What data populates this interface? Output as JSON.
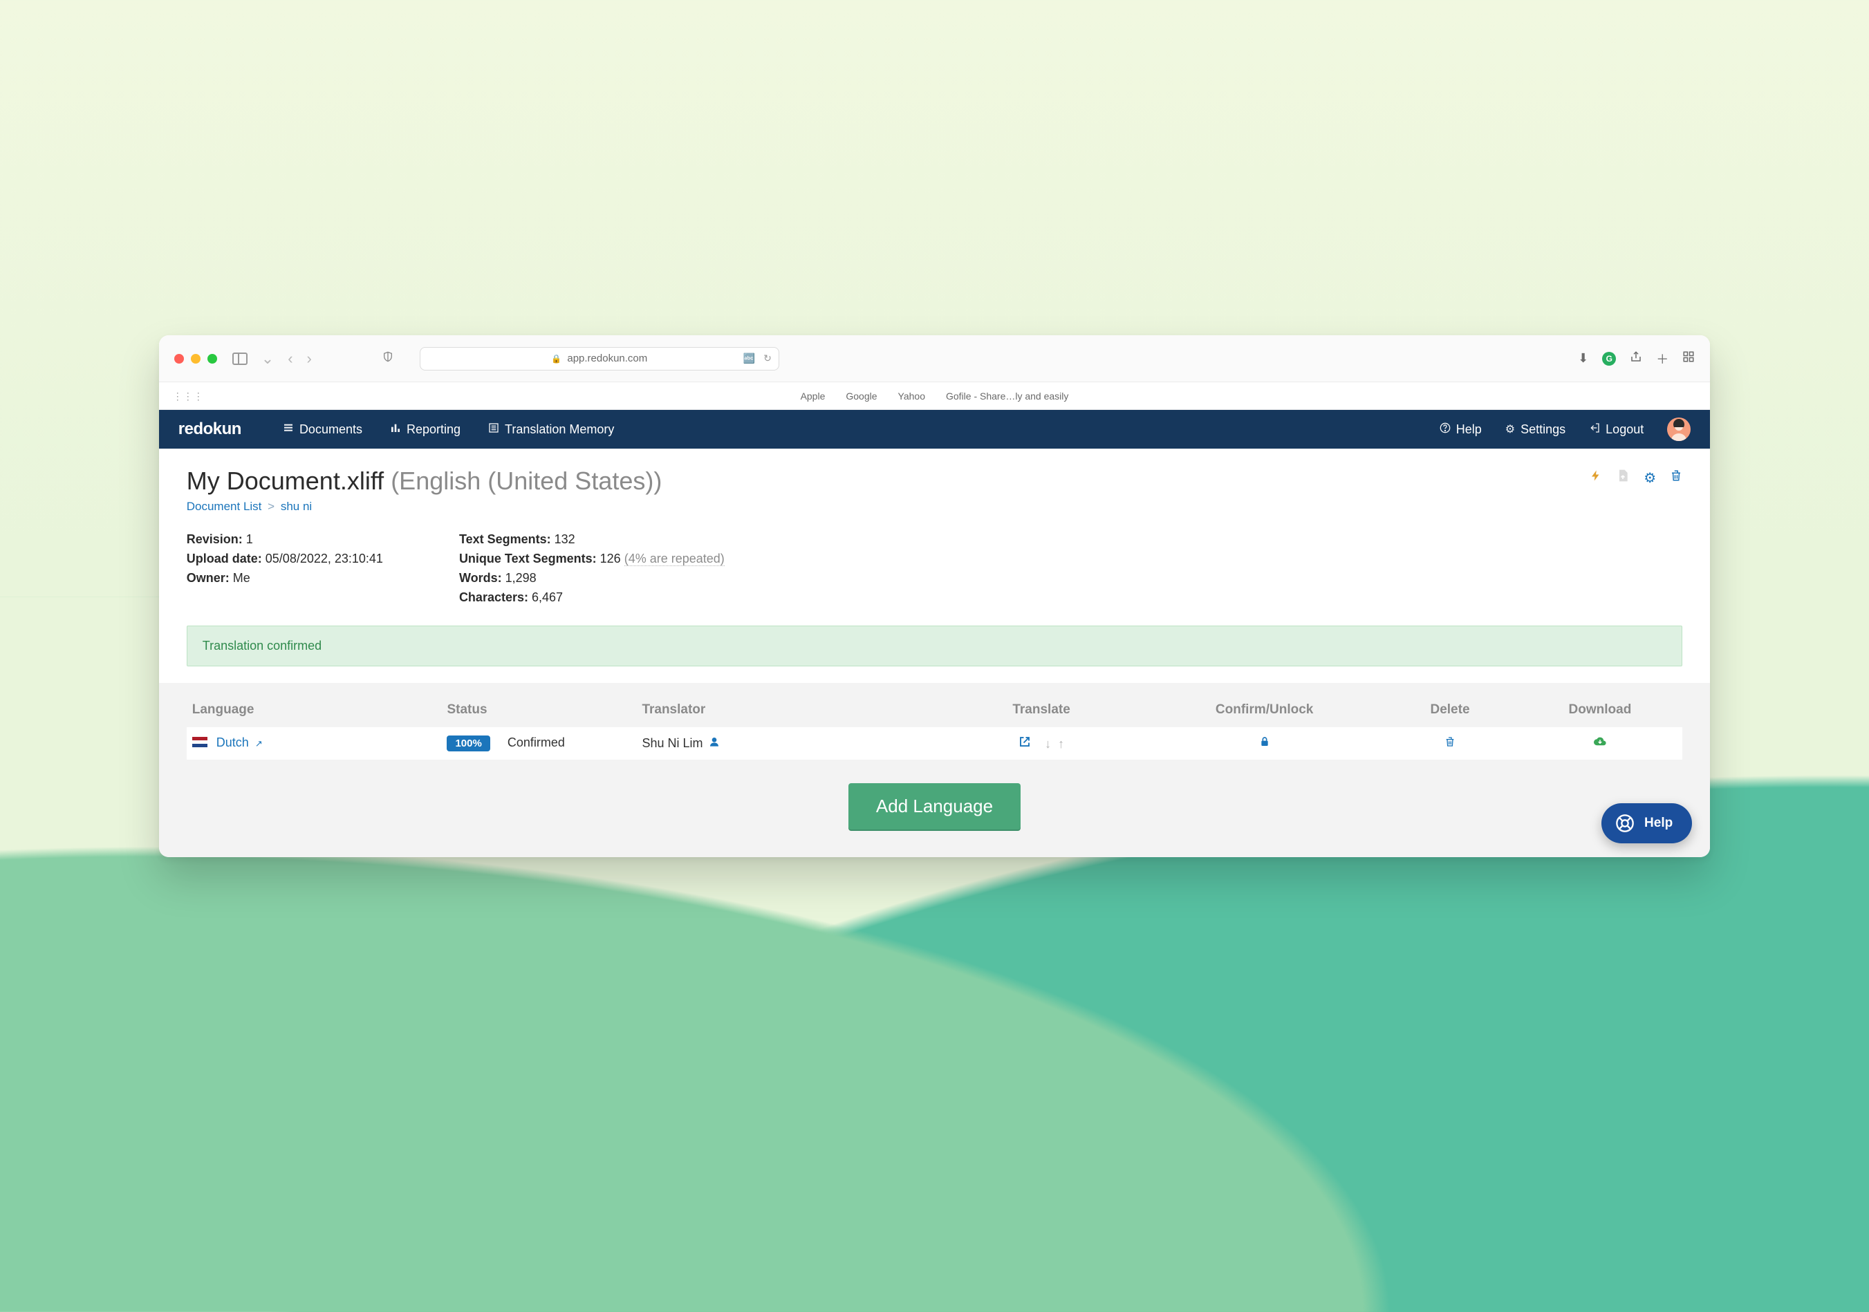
{
  "browser": {
    "url": "app.redokun.com",
    "bookmarks": [
      "Apple",
      "Google",
      "Yahoo",
      "Gofile - Share…ly and easily"
    ],
    "grammarly_letter": "G"
  },
  "nav": {
    "brand": "redokun",
    "links": {
      "documents": "Documents",
      "reporting": "Reporting",
      "tm": "Translation Memory"
    },
    "right": {
      "help": "Help",
      "settings": "Settings",
      "logout": "Logout"
    }
  },
  "title": {
    "name": "My Document.xliff",
    "language": "(English (United States))"
  },
  "breadcrumb": {
    "root": "Document List",
    "current": "shu ni"
  },
  "meta": {
    "revision_label": "Revision:",
    "revision": "1",
    "upload_label": "Upload date:",
    "upload": "05/08/2022, 23:10:41",
    "owner_label": "Owner:",
    "owner": "Me",
    "segments_label": "Text Segments:",
    "segments": "132",
    "unique_label": "Unique Text Segments:",
    "unique": "126",
    "unique_hint": "(4% are repeated)",
    "words_label": "Words:",
    "words": "1,298",
    "chars_label": "Characters:",
    "chars": "6,467"
  },
  "alert": "Translation confirmed",
  "table": {
    "headers": {
      "language": "Language",
      "status": "Status",
      "translator": "Translator",
      "translate": "Translate",
      "confirm": "Confirm/Unlock",
      "delete": "Delete",
      "download": "Download"
    },
    "row": {
      "language": "Dutch",
      "status_badge": "100%",
      "status_text": "Confirmed",
      "translator": "Shu Ni Lim"
    }
  },
  "add_language": "Add Language",
  "help_fab": "Help"
}
